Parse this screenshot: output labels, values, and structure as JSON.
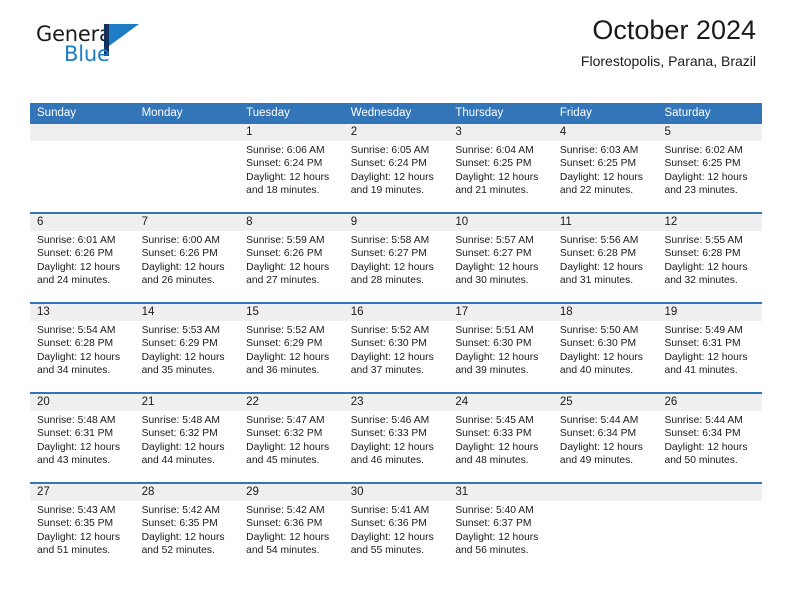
{
  "logo": {
    "word_one": "General",
    "word_two": "Blue",
    "mark": "triangle-mark",
    "color_dark": "#13315c",
    "color_blue": "#1d7cc4"
  },
  "header": {
    "title": "October 2024",
    "subtitle": "Florestopolis, Parana, Brazil"
  },
  "theme": {
    "header_blue": "#3275b8",
    "row_separator": "#3275b8",
    "daynum_background": "#efefef",
    "text": "#1b1b1b"
  },
  "weekdays": [
    "Sunday",
    "Monday",
    "Tuesday",
    "Wednesday",
    "Thursday",
    "Friday",
    "Saturday"
  ],
  "weeks": [
    [
      {
        "day": "",
        "sunrise": "",
        "sunset": "",
        "daylight_line1": "",
        "daylight_line2": ""
      },
      {
        "day": "",
        "sunrise": "",
        "sunset": "",
        "daylight_line1": "",
        "daylight_line2": ""
      },
      {
        "day": "1",
        "sunrise": "Sunrise: 6:06 AM",
        "sunset": "Sunset: 6:24 PM",
        "daylight_line1": "Daylight: 12 hours",
        "daylight_line2": "and 18 minutes."
      },
      {
        "day": "2",
        "sunrise": "Sunrise: 6:05 AM",
        "sunset": "Sunset: 6:24 PM",
        "daylight_line1": "Daylight: 12 hours",
        "daylight_line2": "and 19 minutes."
      },
      {
        "day": "3",
        "sunrise": "Sunrise: 6:04 AM",
        "sunset": "Sunset: 6:25 PM",
        "daylight_line1": "Daylight: 12 hours",
        "daylight_line2": "and 21 minutes."
      },
      {
        "day": "4",
        "sunrise": "Sunrise: 6:03 AM",
        "sunset": "Sunset: 6:25 PM",
        "daylight_line1": "Daylight: 12 hours",
        "daylight_line2": "and 22 minutes."
      },
      {
        "day": "5",
        "sunrise": "Sunrise: 6:02 AM",
        "sunset": "Sunset: 6:25 PM",
        "daylight_line1": "Daylight: 12 hours",
        "daylight_line2": "and 23 minutes."
      }
    ],
    [
      {
        "day": "6",
        "sunrise": "Sunrise: 6:01 AM",
        "sunset": "Sunset: 6:26 PM",
        "daylight_line1": "Daylight: 12 hours",
        "daylight_line2": "and 24 minutes."
      },
      {
        "day": "7",
        "sunrise": "Sunrise: 6:00 AM",
        "sunset": "Sunset: 6:26 PM",
        "daylight_line1": "Daylight: 12 hours",
        "daylight_line2": "and 26 minutes."
      },
      {
        "day": "8",
        "sunrise": "Sunrise: 5:59 AM",
        "sunset": "Sunset: 6:26 PM",
        "daylight_line1": "Daylight: 12 hours",
        "daylight_line2": "and 27 minutes."
      },
      {
        "day": "9",
        "sunrise": "Sunrise: 5:58 AM",
        "sunset": "Sunset: 6:27 PM",
        "daylight_line1": "Daylight: 12 hours",
        "daylight_line2": "and 28 minutes."
      },
      {
        "day": "10",
        "sunrise": "Sunrise: 5:57 AM",
        "sunset": "Sunset: 6:27 PM",
        "daylight_line1": "Daylight: 12 hours",
        "daylight_line2": "and 30 minutes."
      },
      {
        "day": "11",
        "sunrise": "Sunrise: 5:56 AM",
        "sunset": "Sunset: 6:28 PM",
        "daylight_line1": "Daylight: 12 hours",
        "daylight_line2": "and 31 minutes."
      },
      {
        "day": "12",
        "sunrise": "Sunrise: 5:55 AM",
        "sunset": "Sunset: 6:28 PM",
        "daylight_line1": "Daylight: 12 hours",
        "daylight_line2": "and 32 minutes."
      }
    ],
    [
      {
        "day": "13",
        "sunrise": "Sunrise: 5:54 AM",
        "sunset": "Sunset: 6:28 PM",
        "daylight_line1": "Daylight: 12 hours",
        "daylight_line2": "and 34 minutes."
      },
      {
        "day": "14",
        "sunrise": "Sunrise: 5:53 AM",
        "sunset": "Sunset: 6:29 PM",
        "daylight_line1": "Daylight: 12 hours",
        "daylight_line2": "and 35 minutes."
      },
      {
        "day": "15",
        "sunrise": "Sunrise: 5:52 AM",
        "sunset": "Sunset: 6:29 PM",
        "daylight_line1": "Daylight: 12 hours",
        "daylight_line2": "and 36 minutes."
      },
      {
        "day": "16",
        "sunrise": "Sunrise: 5:52 AM",
        "sunset": "Sunset: 6:30 PM",
        "daylight_line1": "Daylight: 12 hours",
        "daylight_line2": "and 37 minutes."
      },
      {
        "day": "17",
        "sunrise": "Sunrise: 5:51 AM",
        "sunset": "Sunset: 6:30 PM",
        "daylight_line1": "Daylight: 12 hours",
        "daylight_line2": "and 39 minutes."
      },
      {
        "day": "18",
        "sunrise": "Sunrise: 5:50 AM",
        "sunset": "Sunset: 6:30 PM",
        "daylight_line1": "Daylight: 12 hours",
        "daylight_line2": "and 40 minutes."
      },
      {
        "day": "19",
        "sunrise": "Sunrise: 5:49 AM",
        "sunset": "Sunset: 6:31 PM",
        "daylight_line1": "Daylight: 12 hours",
        "daylight_line2": "and 41 minutes."
      }
    ],
    [
      {
        "day": "20",
        "sunrise": "Sunrise: 5:48 AM",
        "sunset": "Sunset: 6:31 PM",
        "daylight_line1": "Daylight: 12 hours",
        "daylight_line2": "and 43 minutes."
      },
      {
        "day": "21",
        "sunrise": "Sunrise: 5:48 AM",
        "sunset": "Sunset: 6:32 PM",
        "daylight_line1": "Daylight: 12 hours",
        "daylight_line2": "and 44 minutes."
      },
      {
        "day": "22",
        "sunrise": "Sunrise: 5:47 AM",
        "sunset": "Sunset: 6:32 PM",
        "daylight_line1": "Daylight: 12 hours",
        "daylight_line2": "and 45 minutes."
      },
      {
        "day": "23",
        "sunrise": "Sunrise: 5:46 AM",
        "sunset": "Sunset: 6:33 PM",
        "daylight_line1": "Daylight: 12 hours",
        "daylight_line2": "and 46 minutes."
      },
      {
        "day": "24",
        "sunrise": "Sunrise: 5:45 AM",
        "sunset": "Sunset: 6:33 PM",
        "daylight_line1": "Daylight: 12 hours",
        "daylight_line2": "and 48 minutes."
      },
      {
        "day": "25",
        "sunrise": "Sunrise: 5:44 AM",
        "sunset": "Sunset: 6:34 PM",
        "daylight_line1": "Daylight: 12 hours",
        "daylight_line2": "and 49 minutes."
      },
      {
        "day": "26",
        "sunrise": "Sunrise: 5:44 AM",
        "sunset": "Sunset: 6:34 PM",
        "daylight_line1": "Daylight: 12 hours",
        "daylight_line2": "and 50 minutes."
      }
    ],
    [
      {
        "day": "27",
        "sunrise": "Sunrise: 5:43 AM",
        "sunset": "Sunset: 6:35 PM",
        "daylight_line1": "Daylight: 12 hours",
        "daylight_line2": "and 51 minutes."
      },
      {
        "day": "28",
        "sunrise": "Sunrise: 5:42 AM",
        "sunset": "Sunset: 6:35 PM",
        "daylight_line1": "Daylight: 12 hours",
        "daylight_line2": "and 52 minutes."
      },
      {
        "day": "29",
        "sunrise": "Sunrise: 5:42 AM",
        "sunset": "Sunset: 6:36 PM",
        "daylight_line1": "Daylight: 12 hours",
        "daylight_line2": "and 54 minutes."
      },
      {
        "day": "30",
        "sunrise": "Sunrise: 5:41 AM",
        "sunset": "Sunset: 6:36 PM",
        "daylight_line1": "Daylight: 12 hours",
        "daylight_line2": "and 55 minutes."
      },
      {
        "day": "31",
        "sunrise": "Sunrise: 5:40 AM",
        "sunset": "Sunset: 6:37 PM",
        "daylight_line1": "Daylight: 12 hours",
        "daylight_line2": "and 56 minutes."
      },
      {
        "day": "",
        "sunrise": "",
        "sunset": "",
        "daylight_line1": "",
        "daylight_line2": ""
      },
      {
        "day": "",
        "sunrise": "",
        "sunset": "",
        "daylight_line1": "",
        "daylight_line2": ""
      }
    ]
  ]
}
